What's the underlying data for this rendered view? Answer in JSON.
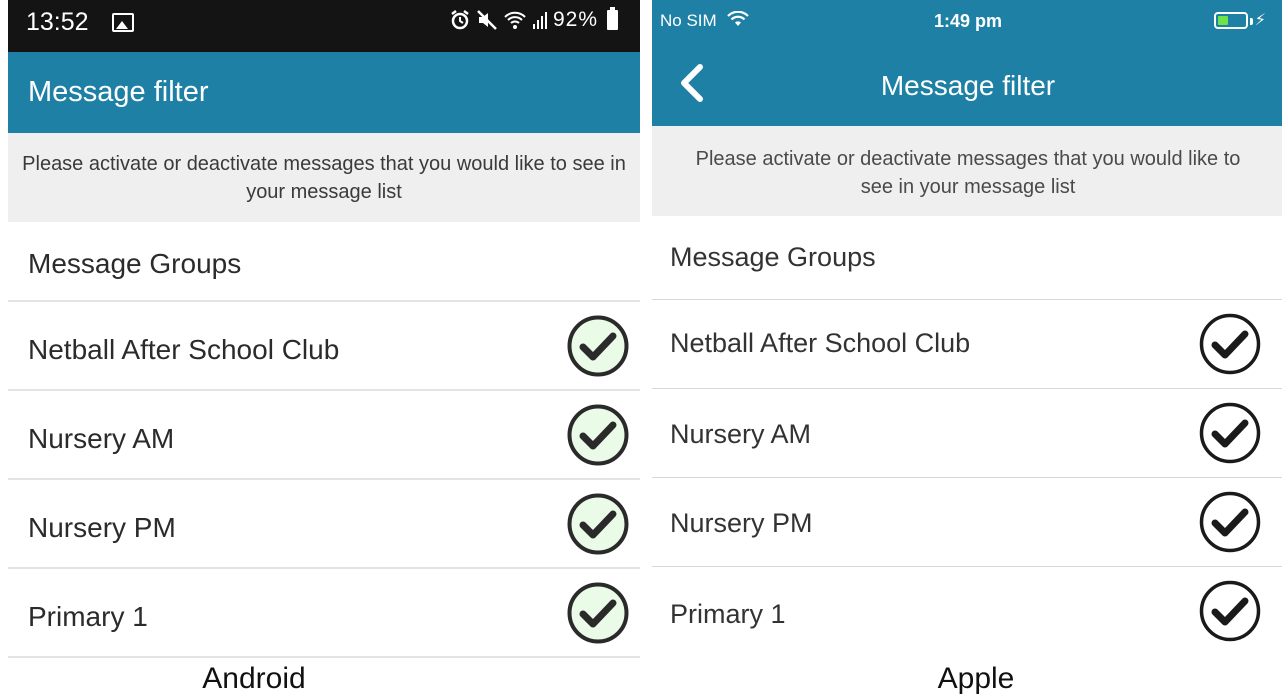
{
  "android": {
    "status_bar": {
      "time": "13:52",
      "battery": "92%"
    },
    "title": "Message filter",
    "info": "Please activate or deactivate messages that you would like to see in your message list",
    "section_header": "Message Groups",
    "groups": [
      {
        "label": "Netball After School Club",
        "checked": true
      },
      {
        "label": "Nursery AM",
        "checked": true
      },
      {
        "label": "Nursery PM",
        "checked": true
      },
      {
        "label": "Primary 1",
        "checked": true
      }
    ],
    "caption": "Android"
  },
  "apple": {
    "status_bar": {
      "carrier": "No SIM",
      "time": "1:49 pm"
    },
    "title": "Message filter",
    "info": "Please activate or deactivate messages that you would like to see in your message list",
    "section_header": "Message Groups",
    "groups": [
      {
        "label": "Netball After School Club",
        "checked": true
      },
      {
        "label": "Nursery AM",
        "checked": true
      },
      {
        "label": "Nursery PM",
        "checked": true
      },
      {
        "label": "Primary 1",
        "checked": true
      }
    ],
    "caption": "Apple"
  },
  "colors": {
    "brand": "#1e80a5",
    "info_background": "#efefef",
    "check_fill": "#eafbe8",
    "check_stroke": "#2a2a2a",
    "battery_fill": "#6fe34a"
  },
  "icons": [
    "gallery-icon",
    "alarm-icon",
    "mute-icon",
    "wifi-icon",
    "signal-icon",
    "battery-icon",
    "back-chevron-icon",
    "checkmark-circle-icon",
    "charging-bolt-icon"
  ]
}
